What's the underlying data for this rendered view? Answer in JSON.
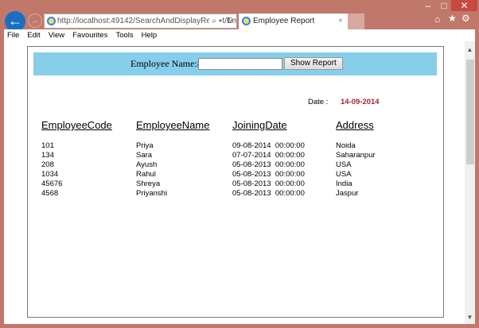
{
  "browser": {
    "url": "http://localhost:49142/SearchAndDisplayReport/Em",
    "url_host": "localhost",
    "tab_title": "Employee Report"
  },
  "menu": [
    "File",
    "Edit",
    "View",
    "Favourites",
    "Tools",
    "Help"
  ],
  "form": {
    "label": "Employee Name:#",
    "input_value": "",
    "button": "Show Report"
  },
  "date": {
    "label": "Date :",
    "value": "14-09-2014",
    "color": "#a0282d"
  },
  "table": {
    "headers": [
      "EmployeeCode",
      "EmployeeName",
      "JoiningDate",
      "Address"
    ],
    "rows": [
      [
        "101",
        "Priya",
        "09-08-2014  00:00:00",
        "Noida"
      ],
      [
        "134",
        "Sara",
        "07-07-2014  00:00:00",
        "Saharanpur"
      ],
      [
        "208",
        "Ayush",
        "05-08-2013  00:00:00",
        "USA"
      ],
      [
        "1034",
        "Rahul",
        "05-08-2013  00:00:00",
        "USA"
      ],
      [
        "45676",
        "Shreya",
        "05-08-2013  00:00:00",
        "India"
      ],
      [
        "4568",
        "Priyanshi",
        "05-08-2013  00:00:00",
        "Jaspur"
      ]
    ]
  }
}
